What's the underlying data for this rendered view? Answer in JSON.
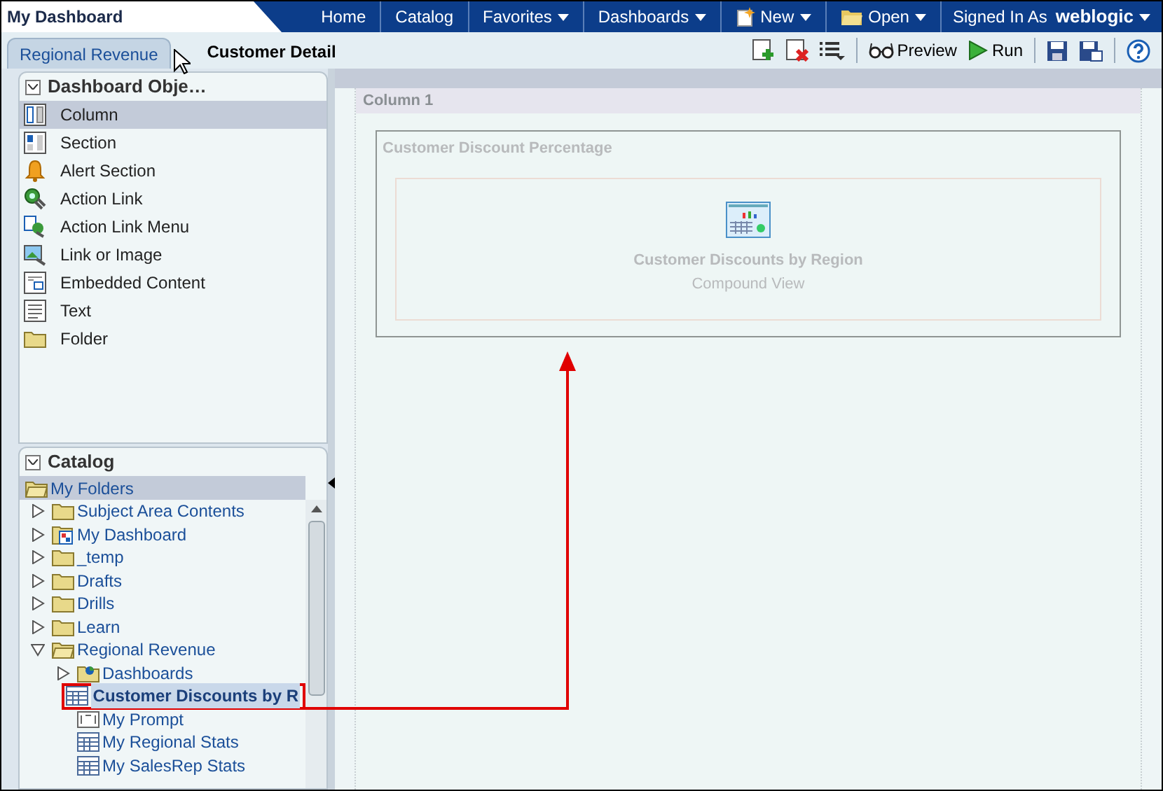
{
  "header": {
    "title": "My Dashboard",
    "nav": [
      {
        "label": "Home",
        "kind": "link"
      },
      {
        "label": "Catalog",
        "kind": "link"
      },
      {
        "label": "Favorites",
        "kind": "menu"
      },
      {
        "label": "Dashboards",
        "kind": "menu"
      },
      {
        "label": "New",
        "kind": "new"
      },
      {
        "label": "Open",
        "kind": "open"
      }
    ],
    "signed_in_label": "Signed In As",
    "user": "weblogic"
  },
  "tabs": [
    {
      "label": "Regional Revenue",
      "selected": false
    },
    {
      "label": "Customer Detail",
      "selected": true
    }
  ],
  "toolbar": {
    "preview": "Preview",
    "run": "Run"
  },
  "dashboard_objects": {
    "title": "Dashboard Obje…",
    "expanded": true,
    "items": [
      {
        "label": "Column",
        "kind": "column",
        "selected": true
      },
      {
        "label": "Section",
        "kind": "section",
        "selected": false
      },
      {
        "label": "Alert Section",
        "kind": "alert",
        "selected": false
      },
      {
        "label": "Action Link",
        "kind": "action-link",
        "selected": false
      },
      {
        "label": "Action Link Menu",
        "kind": "action-menu",
        "selected": false
      },
      {
        "label": "Link or Image",
        "kind": "link-image",
        "selected": false
      },
      {
        "label": "Embedded Content",
        "kind": "embedded",
        "selected": false
      },
      {
        "label": "Text",
        "kind": "text",
        "selected": false
      },
      {
        "label": "Folder",
        "kind": "folder",
        "selected": false
      }
    ]
  },
  "catalog": {
    "title": "Catalog",
    "expanded": true,
    "root": "My Folders",
    "items": [
      {
        "label": "Subject Area Contents",
        "kind": "folder",
        "expanded": false,
        "selected": false
      },
      {
        "label": "My Dashboard",
        "kind": "dashboard",
        "expanded": false,
        "selected": false
      },
      {
        "label": "_temp",
        "kind": "folder",
        "expanded": false,
        "selected": false
      },
      {
        "label": "Drafts",
        "kind": "folder",
        "expanded": false,
        "selected": false
      },
      {
        "label": "Drills",
        "kind": "folder",
        "expanded": false,
        "selected": false
      },
      {
        "label": "Learn",
        "kind": "folder",
        "expanded": false,
        "selected": false
      },
      {
        "label": "Regional Revenue",
        "kind": "folder",
        "expanded": true,
        "selected": false,
        "children": [
          {
            "label": "Dashboards",
            "kind": "dashboards",
            "expanded": false,
            "selected": false
          },
          {
            "label": "Customer Discounts by R",
            "kind": "compound",
            "selected": true
          },
          {
            "label": "My Prompt",
            "kind": "prompt",
            "selected": false
          },
          {
            "label": "My Regional Stats",
            "kind": "analysis",
            "selected": false
          },
          {
            "label": "My SalesRep Stats",
            "kind": "analysis",
            "selected": false
          }
        ]
      }
    ]
  },
  "canvas": {
    "column": "Column 1",
    "section": {
      "title": "Customer Discount Percentage",
      "view": {
        "title": "Customer Discounts by Region",
        "subtitle": "Compound View"
      }
    }
  }
}
